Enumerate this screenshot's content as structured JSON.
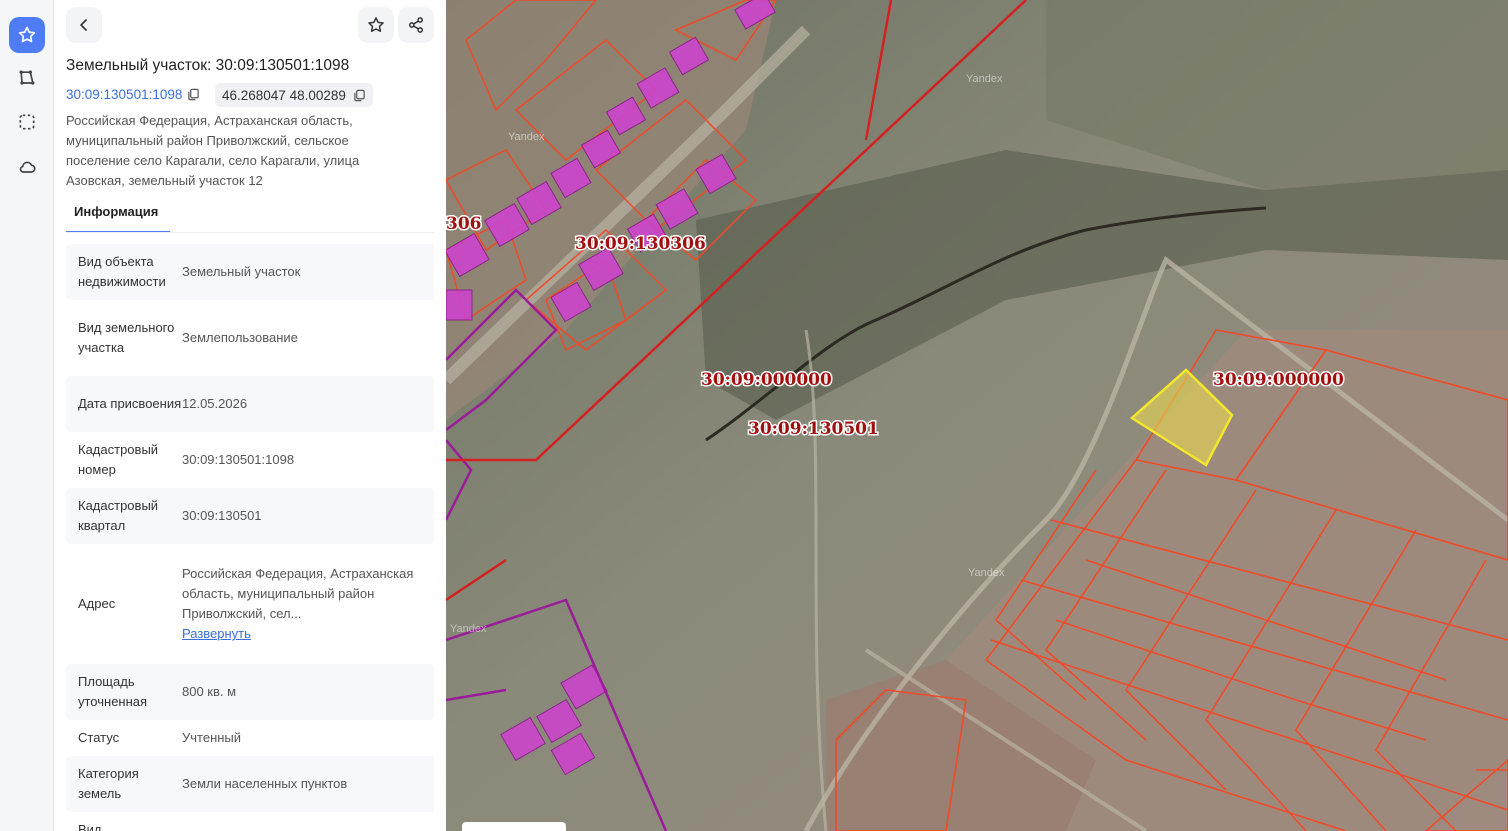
{
  "panel": {
    "title": "Земельный участок: 30:09:130501:1098",
    "cad_link": "30:09:130501:1098",
    "coords": "46.268047 48.00289",
    "address": "Российская Федерация, Астраханская область, муниципальный район Приволжский, сельское поселение село Карагали, село Карагали, улица Азовская, земельный участок 12",
    "tab": "Информация",
    "expand_label": "Развернуть",
    "props": [
      {
        "key": "Вид объекта недвижимости",
        "value": "Земельный участок"
      },
      {
        "key": "Вид земельного участка",
        "value": "Землепользование"
      },
      {
        "key": "Дата присвоения",
        "value": "12.05.2026"
      },
      {
        "key": "Кадастровый номер",
        "value": "30:09:130501:1098"
      },
      {
        "key": "Кадастровый квартал",
        "value": "30:09:130501"
      },
      {
        "key": "Адрес",
        "value": "Российская Федерация, Астраханская область, муниципальный район Приволжский, сел..."
      },
      {
        "key": "Площадь уточненная",
        "value": "800 кв. м"
      },
      {
        "key": "Статус",
        "value": "Учтенный"
      },
      {
        "key": "Категория земель",
        "value": "Земли населенных пунктов"
      },
      {
        "key": "Вид",
        "value": ""
      }
    ]
  },
  "map": {
    "labels": [
      "306",
      "30:09:130306",
      "30:09:000000",
      "30:09:130501",
      "30:09:000000"
    ],
    "watermark": "Yandex"
  },
  "colors": {
    "accent": "#4f7cf5",
    "link": "#3a6fd8",
    "parcel_outline": "#f04a28",
    "quarter_boundary": "#d42020",
    "selected_fill": "#f2e24a",
    "building_fill": "#cc44cc",
    "purple_boundary": "#9b1b9b"
  }
}
